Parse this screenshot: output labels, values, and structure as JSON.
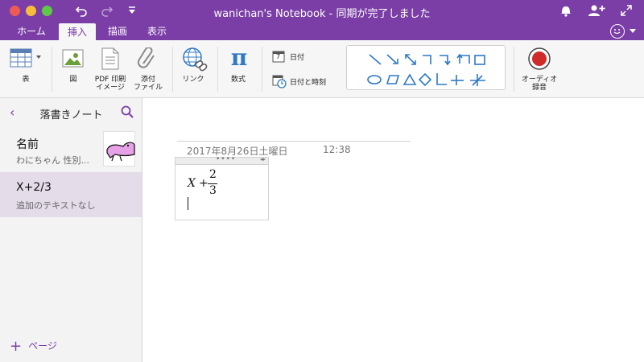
{
  "titlebar": {
    "title": "wanichan's Notebook - 同期が完了しました"
  },
  "tabs": [
    {
      "label": "ホーム",
      "active": false
    },
    {
      "label": "挿入",
      "active": true
    },
    {
      "label": "描画",
      "active": false
    },
    {
      "label": "表示",
      "active": false
    }
  ],
  "ribbon": {
    "table": "表",
    "picture": "図",
    "pdf_printout_line1": "PDF 印刷",
    "pdf_printout_line2": "イメージ",
    "attach_line1": "添付",
    "attach_line2": "ファイル",
    "link": "リンク",
    "equation": "数式",
    "date": "日付",
    "date_time": "日付と時刻",
    "audio_line1": "オーディオ",
    "audio_line2": "録音",
    "calendar_day": "7"
  },
  "sidebar": {
    "section_title": "落書きノート",
    "pages": [
      {
        "title": "名前",
        "subtitle": "わにちゃん 性別..."
      },
      {
        "title": "X+2/3",
        "subtitle": "追加のテキストなし"
      }
    ],
    "add_page": "ページ"
  },
  "note": {
    "date": "2017年8月26日土曜日",
    "time": "12:38",
    "equation": {
      "variable": "X",
      "operator": "+",
      "numerator": "2",
      "denominator": "3"
    }
  },
  "colors": {
    "accent": "#7a3ea6",
    "shapes": "#2f78c4",
    "record": "#d02a2a"
  }
}
